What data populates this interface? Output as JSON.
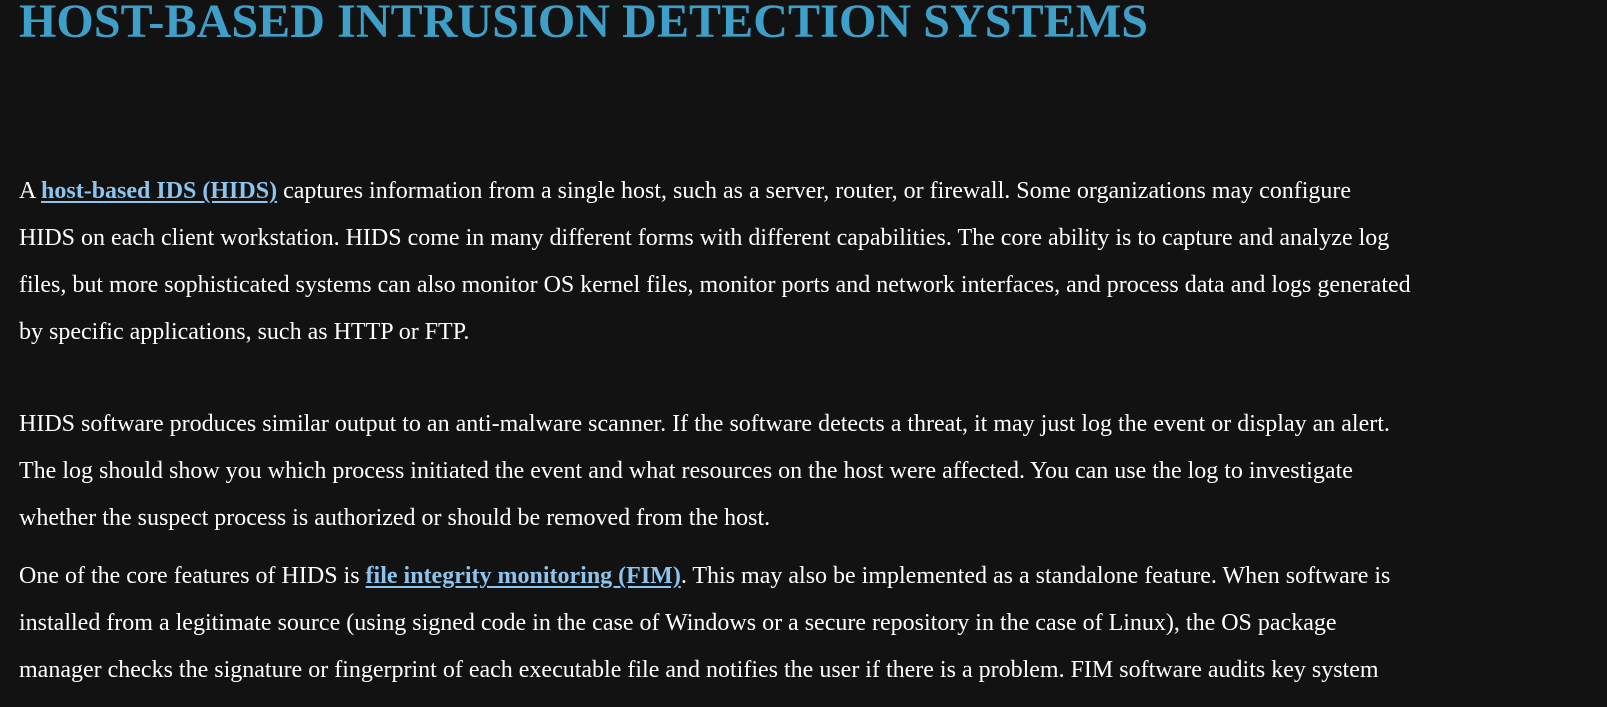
{
  "heading": "HOST-BASED INTRUSION DETECTION SYSTEMS",
  "paragraphs": {
    "p1": {
      "prefix": "A ",
      "link": "host-based IDS (HIDS)",
      "line1_rest": " captures information from a single host, such as a server, router, or firewall. Some organizations may configure",
      "line2": "HIDS on each client workstation. HIDS come in many different forms with different capabilities. The core ability is to capture and analyze log",
      "line3": "files, but more sophisticated systems can also monitor OS kernel files, monitor ports and network interfaces, and process data and logs generated",
      "line4": "by specific applications, such as HTTP or FTP."
    },
    "p2": {
      "line1": "HIDS software produces similar output to an anti-malware scanner. If the software detects a threat, it may just log the event or display an alert.",
      "line2": "The log should show you which process initiated the event and what resources on the host were affected. You can use the log to investigate",
      "line3": "whether the suspect process is authorized or should be removed from the host."
    },
    "p3": {
      "prefix": "One of the core features of HIDS is ",
      "link": "file integrity monitoring (FIM)",
      "line1_rest": ". This may also be implemented as a standalone feature. When software is",
      "line2": "installed from a legitimate source (using signed code in the case of Windows or a secure repository in the case of Linux), the OS package",
      "line3": "manager checks the signature or fingerprint of each executable file and notifies the user if there is a problem. FIM software audits key system"
    }
  },
  "colors": {
    "background": "#121212",
    "heading": "#3ea0c8",
    "text": "#ffffff",
    "link": "#8cc4ee"
  }
}
